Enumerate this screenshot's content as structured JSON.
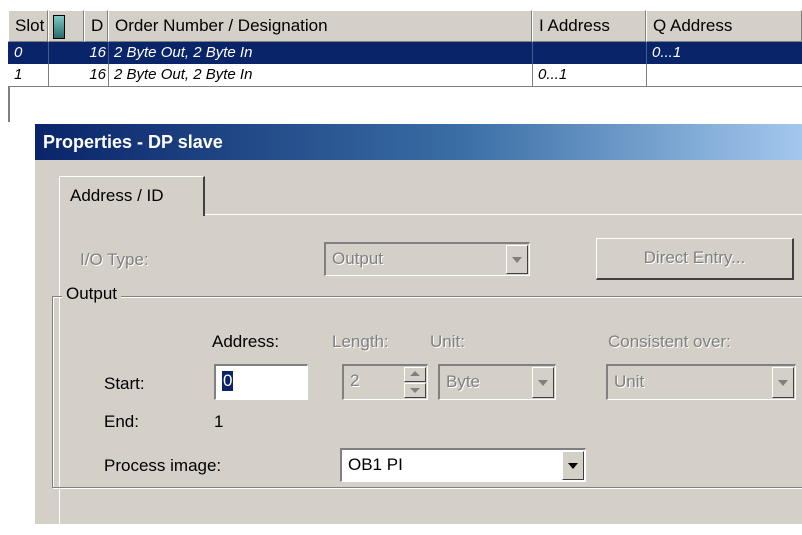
{
  "table": {
    "columns": [
      "Slot",
      "D",
      "Order Number / Designation",
      "I Address",
      "Q Address"
    ],
    "rows": [
      {
        "slot": "0",
        "d": "16",
        "designation": "2 Byte Out, 2 Byte In",
        "i_address": "",
        "q_address": "0...1"
      },
      {
        "slot": "1",
        "d": "16",
        "designation": "2 Byte Out, 2 Byte In",
        "i_address": "0...1",
        "q_address": ""
      }
    ]
  },
  "dialog": {
    "title": "Properties - DP slave",
    "tab_label": "Address / ID",
    "io_type_label": "I/O Type:",
    "io_type_value": "Output",
    "direct_entry_label": "Direct Entry...",
    "group_label": "Output",
    "address_header": "Address:",
    "length_header": "Length:",
    "unit_header": "Unit:",
    "consistent_header": "Consistent over:",
    "start_label": "Start:",
    "start_value": "0",
    "length_value": "2",
    "unit_value": "Byte",
    "consistent_value": "Unit",
    "end_label": "End:",
    "end_value": "1",
    "process_image_label": "Process image:",
    "process_image_value": "OB1 PI"
  }
}
